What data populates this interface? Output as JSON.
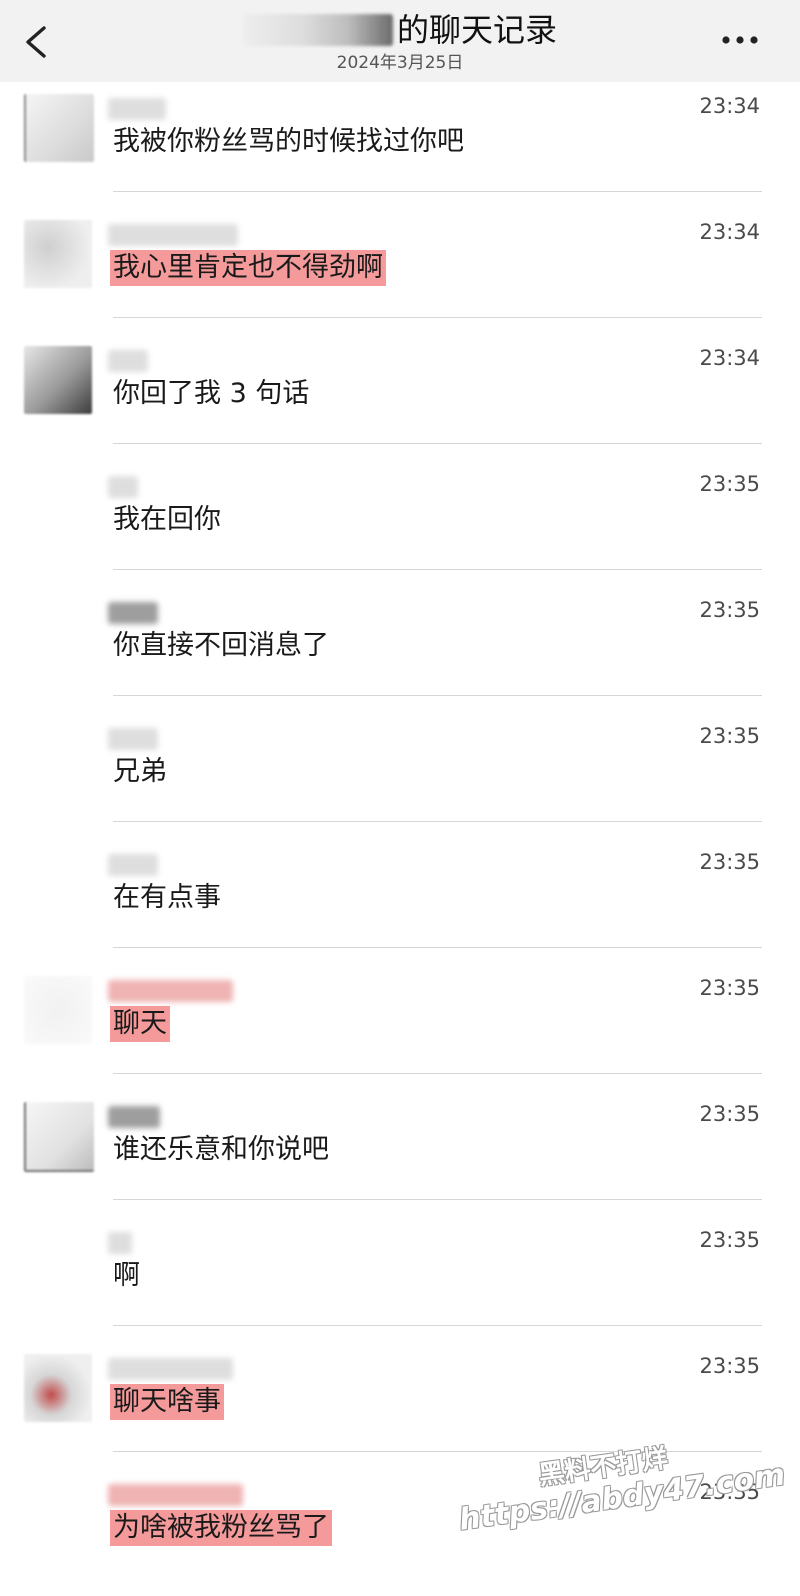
{
  "header": {
    "title": "的聊天记录",
    "subtitle": "2024年3月25日"
  },
  "messages": [
    {
      "time": "23:34",
      "text": "我被你粉丝骂的时候找过你吧",
      "highlighted": false
    },
    {
      "time": "23:34",
      "text": "我心里肯定也不得劲啊",
      "highlighted": true
    },
    {
      "time": "23:34",
      "text": "你回了我 3 句话",
      "highlighted": false
    },
    {
      "time": "23:35",
      "text": "我在回你",
      "highlighted": false
    },
    {
      "time": "23:35",
      "text": "你直接不回消息了",
      "highlighted": false
    },
    {
      "time": "23:35",
      "text": "兄弟",
      "highlighted": false
    },
    {
      "time": "23:35",
      "text": "在有点事",
      "highlighted": false
    },
    {
      "time": "23:35",
      "text": "聊天",
      "highlighted": true
    },
    {
      "time": "23:35",
      "text": "谁还乐意和你说吧",
      "highlighted": false
    },
    {
      "time": "23:35",
      "text": "啊",
      "highlighted": false
    },
    {
      "time": "23:35",
      "text": "聊天啥事",
      "highlighted": true
    },
    {
      "time": "23:35",
      "text": "为啥被我粉丝骂了",
      "highlighted": true
    }
  ],
  "watermark": {
    "line1": "黑料不打烊",
    "line2": "https://abdy47.com"
  },
  "colors": {
    "header_bg": "#f2f2f2",
    "highlight": "#f59a9a",
    "divider": "#d6d6d6"
  },
  "icons": {
    "back": "chevron-left-icon",
    "more": "more-dots-icon"
  }
}
